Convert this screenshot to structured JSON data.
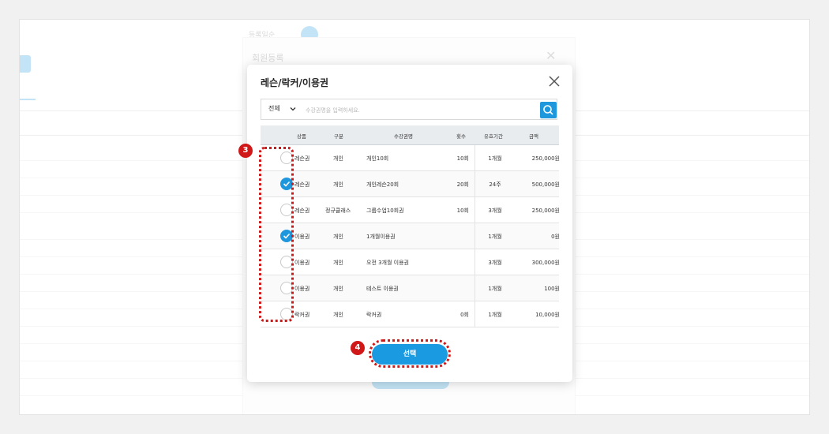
{
  "modal": {
    "title": "레슨/락커/이용권",
    "search": {
      "filter_value": "전체",
      "placeholder": "수강권명을 입력하세요."
    },
    "table": {
      "headers": [
        "상품",
        "구분",
        "수강권명",
        "횟수",
        "유효기간",
        "금액"
      ],
      "rows": [
        {
          "type": "레슨권",
          "division": "개인",
          "name": "개인10회",
          "count": "10회",
          "period": "1개월",
          "price": "250,000원",
          "selected": false
        },
        {
          "type": "레슨권",
          "division": "개인",
          "name": "개인레슨20회",
          "count": "20회",
          "period": "24주",
          "price": "500,000원",
          "selected": true
        },
        {
          "type": "레슨권",
          "division": "정규클래스",
          "name": "그룹수업10회권",
          "count": "10회",
          "period": "3개월",
          "price": "250,000원",
          "selected": false
        },
        {
          "type": "이용권",
          "division": "개인",
          "name": "1개월이용권",
          "count": "",
          "period": "1개월",
          "price": "0원",
          "selected": true
        },
        {
          "type": "이용권",
          "division": "개인",
          "name": "오전 3개월 이용권",
          "count": "",
          "period": "3개월",
          "price": "300,000원",
          "selected": false
        },
        {
          "type": "이용권",
          "division": "개인",
          "name": "테스트 이용권",
          "count": "",
          "period": "1개월",
          "price": "100원",
          "selected": false
        },
        {
          "type": "락커권",
          "division": "개인",
          "name": "락커권",
          "count": "0회",
          "period": "1개월",
          "price": "10,000원",
          "selected": false
        }
      ]
    },
    "select_button": "선택"
  },
  "background": {
    "modal_title": "회원등록",
    "filter_label": "등록일순"
  },
  "annotations": {
    "step_3": "3",
    "step_4": "4"
  },
  "colors": {
    "accent": "#1f97dd",
    "annotation": "#d11818"
  }
}
